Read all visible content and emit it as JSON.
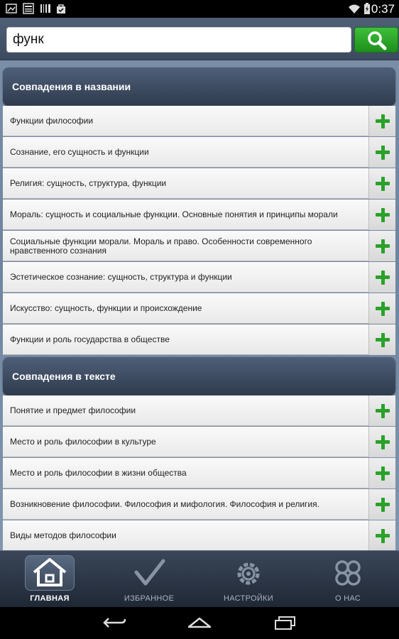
{
  "status_bar": {
    "time": "0:37"
  },
  "search": {
    "value": "функ"
  },
  "sections": [
    {
      "title": "Совпадения в названии",
      "items": [
        "Функции философии",
        "Сознание, его сущность и функции",
        "Религия: сущность, структура, функции",
        "Мораль: сущность и социальные функции. Основные понятия и принципы морали",
        "Социальные функции морали. Мораль и право. Особенности современного нравственного сознания",
        "Эстетическое сознание: сущность, структура и функции",
        "Искусство: сущность, функции и происхождение",
        "Функции и роль государства в обществе"
      ]
    },
    {
      "title": "Совпадения в тексте",
      "items": [
        "Понятие и предмет философии",
        "Место и роль философии в культуре",
        "Место и роль философии в жизни общества",
        "Возникновение философии. Философия и мифология. Философия и религия.",
        "Виды методов философии"
      ]
    }
  ],
  "tabs": [
    {
      "label": "ГЛАВНАЯ",
      "icon": "home-icon",
      "active": true
    },
    {
      "label": "ИЗБРАННОЕ",
      "icon": "checkmark-icon",
      "active": false
    },
    {
      "label": "НАСТРОЙКИ",
      "icon": "gear-icon",
      "active": false
    },
    {
      "label": "О НАС",
      "icon": "clover-icon",
      "active": false
    }
  ],
  "colors": {
    "accent_green": "#2aa12a",
    "header_dark": "#2f3b4d"
  }
}
